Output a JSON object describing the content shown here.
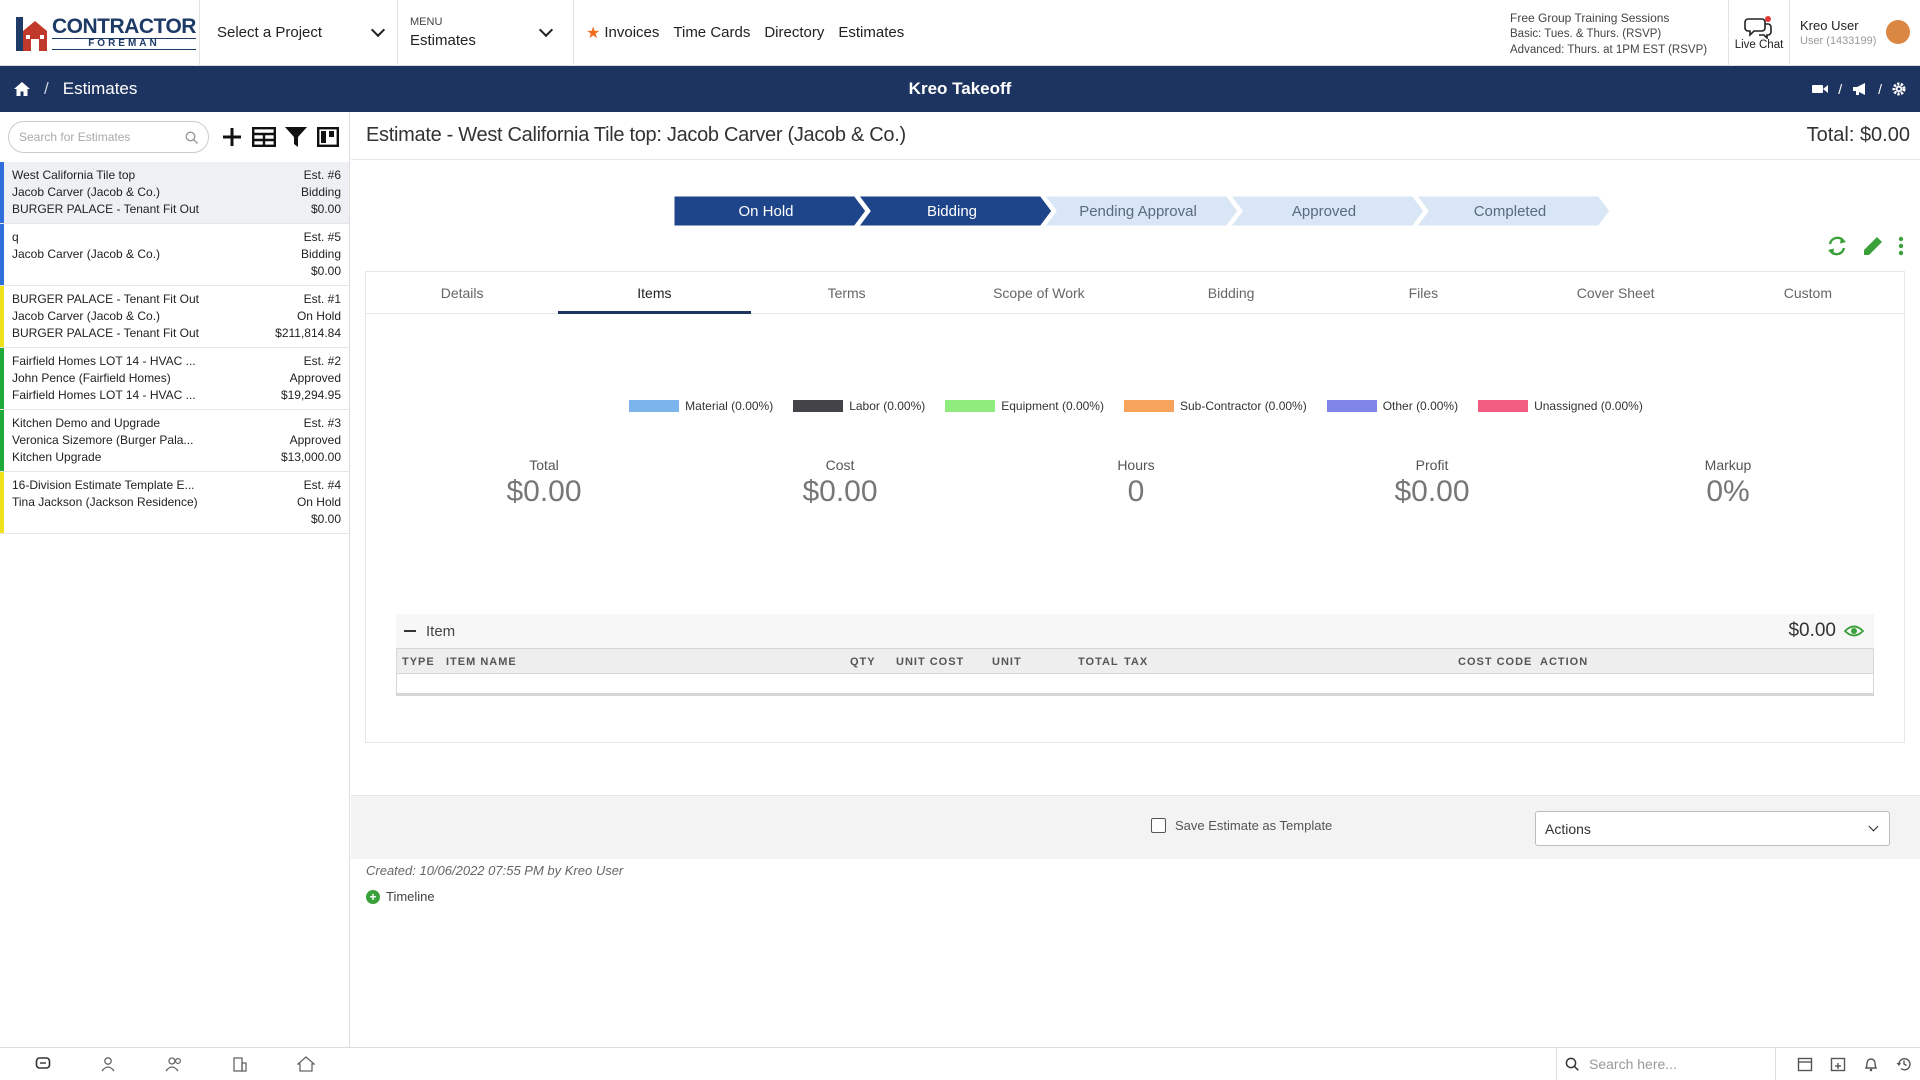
{
  "header": {
    "logo_line1": "CONTRACTOR",
    "logo_line2": "FOREMAN",
    "project_select": "Select a Project",
    "menu_label": "MENU",
    "menu_value": "Estimates",
    "quick_links": [
      "Invoices",
      "Time Cards",
      "Directory",
      "Estimates"
    ],
    "training_title": "Free Group Training Sessions",
    "training_basic": "Basic: Tues. & Thurs. (RSVP)",
    "training_advanced": "Advanced: Thurs. at 1PM EST (RSVP)",
    "live_chat": "Live Chat",
    "user_name": "Kreo User",
    "user_id": "User (1433199)"
  },
  "navbar": {
    "section": "Estimates",
    "center_title": "Kreo Takeoff"
  },
  "sidebar": {
    "search_placeholder": "Search for Estimates",
    "estimates": [
      {
        "l1": "West California Tile top",
        "l2": "Jacob Carver (Jacob & Co.)",
        "l3": "BURGER PALACE - Tenant Fit Out",
        "num": "Est. #6",
        "status": "Bidding",
        "amount": "$0.00",
        "color": "#2f6fdb",
        "selected": true
      },
      {
        "l1": "q",
        "l2": "Jacob Carver (Jacob & Co.)",
        "l3": "",
        "num": "Est. #5",
        "status": "Bidding",
        "amount": "$0.00",
        "color": "#2f6fdb",
        "selected": false
      },
      {
        "l1": "BURGER PALACE - Tenant Fit Out",
        "l2": "Jacob Carver (Jacob & Co.)",
        "l3": "BURGER PALACE - Tenant Fit Out",
        "num": "Est. #1",
        "status": "On Hold",
        "amount": "$211,814.84",
        "color": "#f0e11d",
        "selected": false
      },
      {
        "l1": "Fairfield Homes LOT 14 - HVAC ...",
        "l2": "John Pence (Fairfield Homes)",
        "l3": "Fairfield Homes LOT 14 - HVAC ...",
        "num": "Est. #2",
        "status": "Approved",
        "amount": "$19,294.95",
        "color": "#1faa3a",
        "selected": false
      },
      {
        "l1": "Kitchen Demo and Upgrade",
        "l2": "Veronica Sizemore (Burger Pala...",
        "l3": "Kitchen Upgrade",
        "num": "Est. #3",
        "status": "Approved",
        "amount": "$13,000.00",
        "color": "#1faa3a",
        "selected": false
      },
      {
        "l1": "16-Division Estimate Template E...",
        "l2": "Tina Jackson (Jackson Residence)",
        "l3": "",
        "num": "Est. #4",
        "status": "On Hold",
        "amount": "$0.00",
        "color": "#f0e11d",
        "selected": false
      }
    ]
  },
  "main": {
    "title": "Estimate - West California Tile top: Jacob Carver (Jacob & Co.)",
    "total": "Total: $0.00",
    "stages": [
      {
        "label": "On Hold",
        "done": true
      },
      {
        "label": "Bidding",
        "done": true
      },
      {
        "label": "Pending Approval",
        "done": false
      },
      {
        "label": "Approved",
        "done": false
      },
      {
        "label": "Completed",
        "done": false
      }
    ],
    "tabs": [
      "Details",
      "Items",
      "Terms",
      "Scope of Work",
      "Bidding",
      "Files",
      "Cover Sheet",
      "Custom"
    ],
    "active_tab": "Items",
    "legend": [
      {
        "label": "Material (0.00%)",
        "color": "#7cb5ec"
      },
      {
        "label": "Labor (0.00%)",
        "color": "#434348"
      },
      {
        "label": "Equipment (0.00%)",
        "color": "#90ed7d"
      },
      {
        "label": "Sub-Contractor (0.00%)",
        "color": "#f7a35c"
      },
      {
        "label": "Other (0.00%)",
        "color": "#8085e9"
      },
      {
        "label": "Unassigned (0.00%)",
        "color": "#f15c80"
      }
    ],
    "stats": [
      {
        "label": "Total",
        "value": "$0.00"
      },
      {
        "label": "Cost",
        "value": "$0.00"
      },
      {
        "label": "Hours",
        "value": "0"
      },
      {
        "label": "Profit",
        "value": "$0.00"
      },
      {
        "label": "Markup",
        "value": "0%"
      }
    ],
    "item_section": {
      "name": "Item",
      "amount": "$0.00",
      "columns": {
        "type": "TYPE",
        "item_name": "ITEM NAME",
        "qty": "QTY",
        "unit_cost": "UNIT COST",
        "unit": "UNIT",
        "total": "TOTAL",
        "tax": "TAX",
        "cost_code": "COST CODE",
        "action": "ACTION"
      }
    },
    "save_template": "Save Estimate as Template",
    "actions_select": "Actions",
    "created": "Created: 10/06/2022 07:55 PM by Kreo User",
    "timeline": "Timeline"
  },
  "bottombar": {
    "search_placeholder": "Search here..."
  },
  "colors": {
    "navy": "#1e3460",
    "stage_done": "#1e4489",
    "stage_pending": "#d9e6f5",
    "accent_green": "#3aa03a"
  }
}
